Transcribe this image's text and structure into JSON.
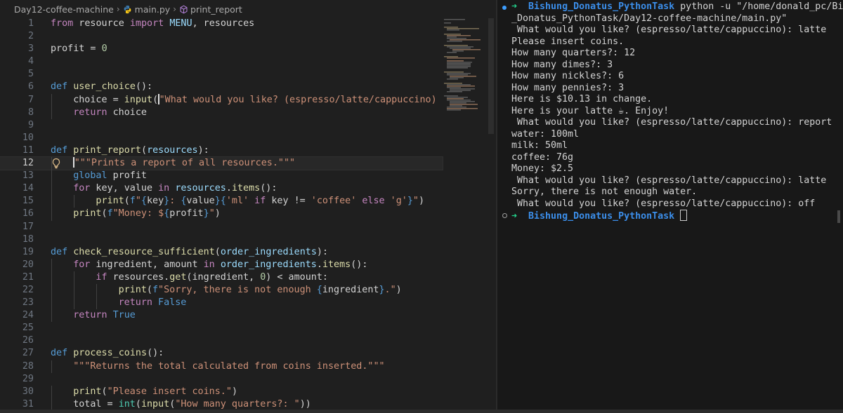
{
  "breadcrumb": {
    "folder": "Day12-coffee-machine",
    "file": "main.py",
    "symbol": "print_report"
  },
  "editor": {
    "current_line": 12,
    "lines": [
      {
        "n": "1",
        "indent": 0,
        "tokens": [
          [
            "kw",
            "from"
          ],
          [
            "plain",
            " resource "
          ],
          [
            "kw",
            "import"
          ],
          [
            "plain",
            " "
          ],
          [
            "var",
            "MENU"
          ],
          [
            "plain",
            ", resources"
          ]
        ]
      },
      {
        "n": "2",
        "indent": 0,
        "tokens": []
      },
      {
        "n": "3",
        "indent": 0,
        "tokens": [
          [
            "plain",
            "profit = "
          ],
          [
            "num",
            "0"
          ]
        ]
      },
      {
        "n": "4",
        "indent": 0,
        "tokens": []
      },
      {
        "n": "5",
        "indent": 0,
        "tokens": []
      },
      {
        "n": "6",
        "indent": 0,
        "tokens": [
          [
            "kwd",
            "def"
          ],
          [
            "plain",
            " "
          ],
          [
            "fn",
            "user_choice"
          ],
          [
            "plain",
            "():"
          ]
        ]
      },
      {
        "n": "7",
        "indent": 1,
        "tokens": [
          [
            "plain",
            "choice = "
          ],
          [
            "fn",
            "input"
          ],
          [
            "plain",
            "("
          ],
          [
            "cursor",
            ""
          ],
          [
            "str",
            "\"What would you like? (espresso/latte/cappuccino)"
          ]
        ]
      },
      {
        "n": "8",
        "indent": 1,
        "tokens": [
          [
            "kw",
            "return"
          ],
          [
            "plain",
            " choice"
          ]
        ]
      },
      {
        "n": "9",
        "indent": 0,
        "tokens": []
      },
      {
        "n": "10",
        "indent": 0,
        "tokens": []
      },
      {
        "n": "11",
        "indent": 0,
        "tokens": [
          [
            "kwd",
            "def"
          ],
          [
            "plain",
            " "
          ],
          [
            "fn",
            "print_report"
          ],
          [
            "plain",
            "("
          ],
          [
            "var",
            "resources"
          ],
          [
            "plain",
            "):"
          ]
        ]
      },
      {
        "n": "12",
        "indent": 1,
        "tokens": [
          [
            "cursor",
            ""
          ],
          [
            "str",
            "\"\"\"Prints a report of all resources.\"\"\""
          ]
        ]
      },
      {
        "n": "13",
        "indent": 1,
        "tokens": [
          [
            "kwd",
            "global"
          ],
          [
            "plain",
            " profit"
          ]
        ]
      },
      {
        "n": "14",
        "indent": 1,
        "tokens": [
          [
            "kw",
            "for"
          ],
          [
            "plain",
            " key, value "
          ],
          [
            "kw",
            "in"
          ],
          [
            "plain",
            " "
          ],
          [
            "var",
            "resources"
          ],
          [
            "plain",
            "."
          ],
          [
            "fn",
            "items"
          ],
          [
            "plain",
            "():"
          ]
        ]
      },
      {
        "n": "15",
        "indent": 2,
        "tokens": [
          [
            "fn",
            "print"
          ],
          [
            "plain",
            "("
          ],
          [
            "kwd",
            "f"
          ],
          [
            "str",
            "\""
          ],
          [
            "brace",
            "{"
          ],
          [
            "plain",
            "key"
          ],
          [
            "brace",
            "}"
          ],
          [
            "str",
            ": "
          ],
          [
            "brace",
            "{"
          ],
          [
            "plain",
            "value"
          ],
          [
            "brace",
            "}{"
          ],
          [
            "str",
            "'ml'"
          ],
          [
            "plain",
            " "
          ],
          [
            "kw",
            "if"
          ],
          [
            "plain",
            " key != "
          ],
          [
            "str",
            "'coffee'"
          ],
          [
            "plain",
            " "
          ],
          [
            "kw",
            "else"
          ],
          [
            "plain",
            " "
          ],
          [
            "str",
            "'g'"
          ],
          [
            "brace",
            "}"
          ],
          [
            "str",
            "\""
          ],
          [
            "plain",
            ")"
          ]
        ]
      },
      {
        "n": "16",
        "indent": 1,
        "tokens": [
          [
            "fn",
            "print"
          ],
          [
            "plain",
            "("
          ],
          [
            "kwd",
            "f"
          ],
          [
            "str",
            "\"Money: $"
          ],
          [
            "brace",
            "{"
          ],
          [
            "plain",
            "profit"
          ],
          [
            "brace",
            "}"
          ],
          [
            "str",
            "\""
          ],
          [
            "plain",
            ")"
          ]
        ]
      },
      {
        "n": "17",
        "indent": 0,
        "tokens": []
      },
      {
        "n": "18",
        "indent": 0,
        "tokens": []
      },
      {
        "n": "19",
        "indent": 0,
        "tokens": [
          [
            "kwd",
            "def"
          ],
          [
            "plain",
            " "
          ],
          [
            "fn",
            "check_resource_sufficient"
          ],
          [
            "plain",
            "("
          ],
          [
            "var",
            "order_ingredients"
          ],
          [
            "plain",
            "):"
          ]
        ]
      },
      {
        "n": "20",
        "indent": 1,
        "tokens": [
          [
            "kw",
            "for"
          ],
          [
            "plain",
            " ingredient, amount "
          ],
          [
            "kw",
            "in"
          ],
          [
            "plain",
            " "
          ],
          [
            "var",
            "order_ingredients"
          ],
          [
            "plain",
            "."
          ],
          [
            "fn",
            "items"
          ],
          [
            "plain",
            "():"
          ]
        ]
      },
      {
        "n": "21",
        "indent": 2,
        "tokens": [
          [
            "kw",
            "if"
          ],
          [
            "plain",
            " resources."
          ],
          [
            "fn",
            "get"
          ],
          [
            "plain",
            "(ingredient, "
          ],
          [
            "num",
            "0"
          ],
          [
            "plain",
            ") < amount:"
          ]
        ]
      },
      {
        "n": "22",
        "indent": 3,
        "tokens": [
          [
            "fn",
            "print"
          ],
          [
            "plain",
            "("
          ],
          [
            "kwd",
            "f"
          ],
          [
            "str",
            "\"Sorry, there is not enough "
          ],
          [
            "brace",
            "{"
          ],
          [
            "plain",
            "ingredient"
          ],
          [
            "brace",
            "}"
          ],
          [
            "str",
            ".\""
          ],
          [
            "plain",
            ")"
          ]
        ]
      },
      {
        "n": "23",
        "indent": 3,
        "tokens": [
          [
            "kw",
            "return"
          ],
          [
            "plain",
            " "
          ],
          [
            "kwd",
            "False"
          ]
        ]
      },
      {
        "n": "24",
        "indent": 1,
        "tokens": [
          [
            "kw",
            "return"
          ],
          [
            "plain",
            " "
          ],
          [
            "kwd",
            "True"
          ]
        ]
      },
      {
        "n": "25",
        "indent": 0,
        "tokens": []
      },
      {
        "n": "26",
        "indent": 0,
        "tokens": []
      },
      {
        "n": "27",
        "indent": 0,
        "tokens": [
          [
            "kwd",
            "def"
          ],
          [
            "plain",
            " "
          ],
          [
            "fn",
            "process_coins"
          ],
          [
            "plain",
            "():"
          ]
        ]
      },
      {
        "n": "28",
        "indent": 1,
        "tokens": [
          [
            "str",
            "\"\"\"Returns the total calculated from coins inserted.\"\"\""
          ]
        ]
      },
      {
        "n": "29",
        "indent": 0,
        "tokens": []
      },
      {
        "n": "30",
        "indent": 1,
        "tokens": [
          [
            "fn",
            "print"
          ],
          [
            "plain",
            "("
          ],
          [
            "str",
            "\"Please insert coins.\""
          ],
          [
            "plain",
            ")"
          ]
        ]
      },
      {
        "n": "31",
        "indent": 1,
        "tokens": [
          [
            "plain",
            "total = "
          ],
          [
            "cls",
            "int"
          ],
          [
            "plain",
            "("
          ],
          [
            "fn",
            "input"
          ],
          [
            "plain",
            "("
          ],
          [
            "str",
            "\"How many quarters?: \""
          ],
          [
            "plain",
            "))"
          ]
        ]
      }
    ]
  },
  "terminal": {
    "prompt_dir": "Bishung_Donatus_PythonTask",
    "arrow": "➜",
    "command": " python -u \"/home/donald_pc/Bishung",
    "command_cont": "_Donatus_PythonTask/Day12-coffee-machine/main.py\"",
    "output": [
      " What would you like? (espresso/latte/cappuccino): latte",
      "Please insert coins.",
      "How many quarters?: 12",
      "How many dimes?: 3",
      "How many nickles?: 6",
      "How many pennies?: 3",
      "Here is $10.13 in change.",
      "Here is your latte ☕. Enjoy!",
      " What would you like? (espresso/latte/cappuccino): report",
      "water: 100ml",
      "milk: 50ml",
      "coffee: 76g",
      "Money: $2.5",
      " What would you like? (espresso/latte/cappuccino): latte",
      "Sorry, there is not enough water.",
      " What would you like? (espresso/latte/cappuccino): off"
    ]
  },
  "colors": {
    "editor_bg": "#1f1f1f",
    "terminal_bg": "#181818",
    "keyword": "#c586c0",
    "function": "#dcdcaa",
    "string": "#ce9178",
    "prompt_arrow": "#23d18b",
    "prompt_dir": "#3b8eea"
  },
  "icons": {
    "breadcrumb_separator": "chevron-right-icon",
    "file_icon": "python-file-icon",
    "symbol_icon": "symbol-method-icon",
    "hint_icon": "lightbulb-icon"
  }
}
